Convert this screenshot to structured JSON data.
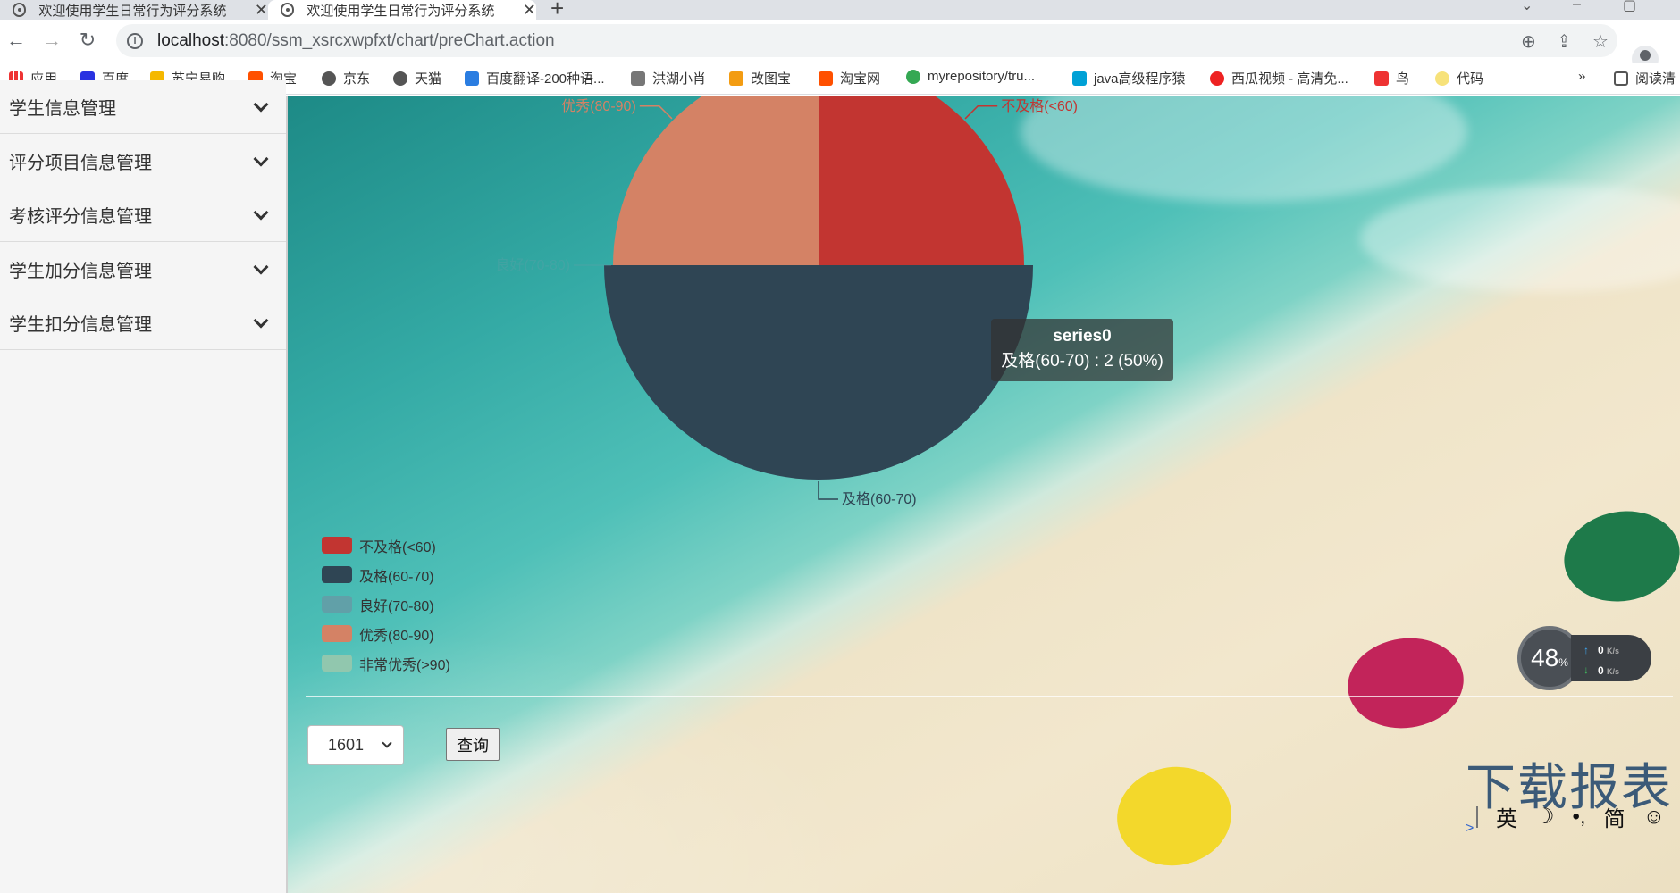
{
  "browser": {
    "tabs": [
      {
        "title": "欢迎使用学生日常行为评分系统"
      },
      {
        "title": "欢迎使用学生日常行为评分系统"
      }
    ],
    "url_host": "localhost",
    "url_path": ":8080/ssm_xsrcxwpfxt/chart/preChart.action",
    "bookmarks": [
      "应用",
      "百度",
      "苏宁易购",
      "淘宝",
      "京东",
      "天猫",
      "百度翻译-200种语...",
      "洪湖小肖",
      "改图宝",
      "淘宝网",
      "myrepository/tru...",
      "java高级程序猿",
      "西瓜视频 - 高清免...",
      "鸟",
      "代码"
    ],
    "bookmarks_overflow": "»",
    "reading_list": "阅读清"
  },
  "sidebar": {
    "items": [
      {
        "label": "学生信息管理"
      },
      {
        "label": "评分项目信息管理"
      },
      {
        "label": "考核评分信息管理"
      },
      {
        "label": "学生加分信息管理"
      },
      {
        "label": "学生扣分信息管理"
      }
    ]
  },
  "chart_data": {
    "type": "pie",
    "series_name": "series0",
    "categories": [
      "不及格(<60)",
      "及格(60-70)",
      "良好(70-80)",
      "优秀(80-90)",
      "非常优秀(>90)"
    ],
    "values": [
      1,
      2,
      0,
      1,
      0
    ],
    "colors": [
      "#c23531",
      "#2f4554",
      "#61a0a8",
      "#d48265",
      "#91c7ae"
    ],
    "slice_labels": [
      "不及格(<60)",
      "及格(60-70)",
      "良好(70-80)",
      "优秀(80-90)"
    ],
    "legend_position": "bottom-left",
    "tooltip": {
      "title": "series0",
      "text": "及格(60-70) : 2 (50%)"
    }
  },
  "controls": {
    "class_select_value": "1601",
    "query_button": "查询"
  },
  "overlay": {
    "speed_percent": "48",
    "speed_unit": "%",
    "upload": "0",
    "download": "0",
    "speed_unit_rate": "K/s",
    "download_report": "下载报表"
  },
  "ime": {
    "lang": "英",
    "moon": "☽",
    "punct": "•,",
    "mode": "简",
    "emoji": "☺"
  }
}
